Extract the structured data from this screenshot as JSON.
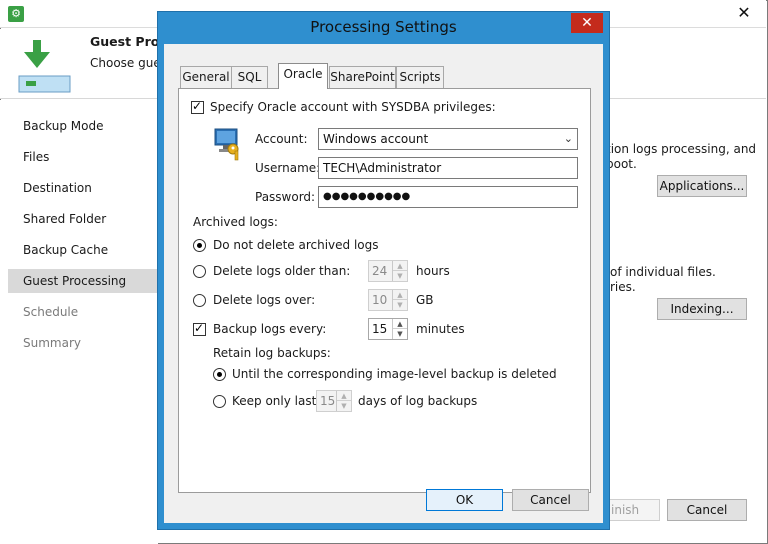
{
  "background_window": {
    "header": {
      "title": "Guest Proce",
      "subtitle": "Choose gues"
    },
    "nav": [
      {
        "label": "Backup Mode",
        "state": "normal"
      },
      {
        "label": "Files",
        "state": "normal"
      },
      {
        "label": "Destination",
        "state": "normal"
      },
      {
        "label": "Shared Folder",
        "state": "normal"
      },
      {
        "label": "Backup Cache",
        "state": "normal"
      },
      {
        "label": "Guest Processing",
        "state": "active"
      },
      {
        "label": "Schedule",
        "state": "disabled"
      },
      {
        "label": "Summary",
        "state": "disabled"
      }
    ],
    "content": {
      "text1_line1": "tion logs processing, and",
      "text1_line2": "boot.",
      "applications_button": "Applications...",
      "text2_line1": "of individual files.",
      "text2_line2": "ries.",
      "indexing_button": "Indexing...",
      "finish_button": "inish",
      "cancel_button": "Cancel"
    }
  },
  "dialog": {
    "title": "Processing Settings",
    "close_glyph": "✕",
    "tabs": [
      "General",
      "SQL",
      "Oracle",
      "SharePoint",
      "Scripts"
    ],
    "active_tab": "Oracle",
    "sysdba": {
      "label": "Specify Oracle account with SYSDBA privileges:",
      "checked": true
    },
    "account": {
      "label": "Account:",
      "value": "Windows account"
    },
    "username": {
      "label": "Username:",
      "value": "TECH\\Administrator"
    },
    "password": {
      "label": "Password:",
      "value": "●●●●●●●●●●"
    },
    "archived_logs": {
      "heading": "Archived logs:",
      "do_not_delete": {
        "label": "Do not delete archived logs",
        "checked": true
      },
      "delete_older": {
        "label": "Delete logs older than:",
        "value": "24",
        "unit": "hours"
      },
      "delete_over": {
        "label": "Delete logs over:",
        "value": "10",
        "unit": "GB"
      },
      "backup_every": {
        "label": "Backup logs every:",
        "value": "15",
        "unit": "minutes",
        "checked": true
      }
    },
    "retain": {
      "heading": "Retain log backups:",
      "until_deleted": {
        "label": "Until the corresponding image-level backup is deleted",
        "checked": true
      },
      "keep_only": {
        "label": "Keep only last",
        "value": "15",
        "unit": "days of log backups"
      }
    },
    "buttons": {
      "ok": "OK",
      "cancel": "Cancel"
    }
  }
}
